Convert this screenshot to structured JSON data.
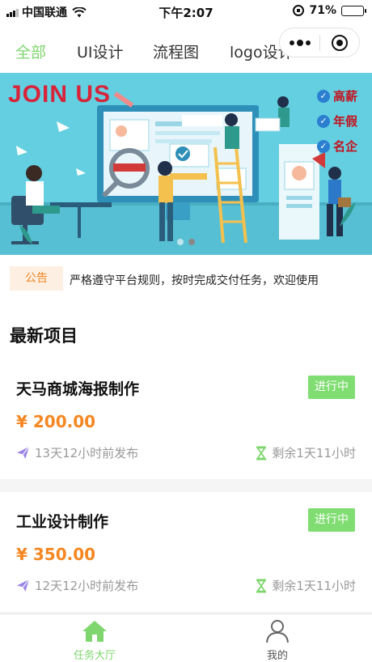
{
  "status_bar": {
    "carrier": "中国联通",
    "time": "下午2:07",
    "battery": "71%",
    "battery_level": 0.71
  },
  "tabs": [
    {
      "label": "全部",
      "active": true
    },
    {
      "label": "UI设计",
      "active": false
    },
    {
      "label": "流程图",
      "active": false
    },
    {
      "label": "logo设计",
      "active": false
    }
  ],
  "capsule": {
    "more_icon": "more-dots-icon",
    "close_icon": "target-circle-icon"
  },
  "banner": {
    "title": "JOIN US",
    "badges": [
      "高薪",
      "年假",
      "名企"
    ],
    "slides": 2,
    "active_slide": 1
  },
  "notice": {
    "tag": "公告",
    "text": "严格遵守平台规则，按时完成交付任务，欢迎使用"
  },
  "section_title": "最新项目",
  "projects": [
    {
      "title": "天马商城海报制作",
      "status": "进行中",
      "price": "¥ 200.00",
      "posted": "13天12小时前发布",
      "remaining": "剩余1天11小时"
    },
    {
      "title": "工业设计制作",
      "status": "进行中",
      "price": "¥ 350.00",
      "posted": "12天12小时前发布",
      "remaining": "剩余1天11小时"
    }
  ],
  "tabbar": [
    {
      "label": "任务大厅",
      "icon": "home-icon",
      "active": true
    },
    {
      "label": "我的",
      "icon": "user-icon",
      "active": false
    }
  ],
  "colors": {
    "accent": "#7fd66e",
    "price": "#f58722",
    "icon_purple": "#9a85e6",
    "icon_green": "#7fd66e",
    "notice_tag_bg": "#fdf0e2",
    "notice_tag_text": "#f08322"
  }
}
